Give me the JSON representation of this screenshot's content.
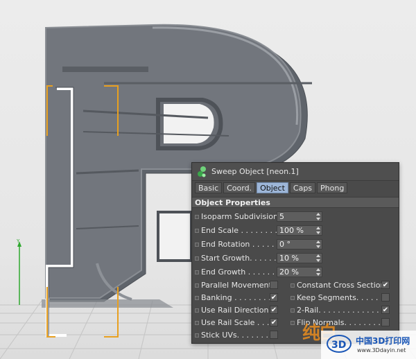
{
  "panel": {
    "title": "Sweep Object [neon.1]",
    "tabs": [
      {
        "label": "Basic",
        "active": false
      },
      {
        "label": "Coord.",
        "active": false
      },
      {
        "label": "Object",
        "active": true
      },
      {
        "label": "Caps",
        "active": false
      },
      {
        "label": "Phong",
        "active": false
      }
    ],
    "section_title": "Object Properties",
    "numeric_fields": [
      {
        "label": "Isoparm Subdivision",
        "value": "5"
      },
      {
        "label": "End Scale . . . . . . . . .",
        "value": "100 %"
      },
      {
        "label": "End Rotation . . . . . .",
        "value": "0 °"
      },
      {
        "label": "Start Growth. . . . . . .",
        "value": "10 %"
      },
      {
        "label": "End Growth . . . . . . .",
        "value": "20 %"
      }
    ],
    "checkboxes_left": [
      {
        "label": "Parallel Movement",
        "checked": false
      },
      {
        "label": "Banking . . . . . . . . .",
        "checked": true
      },
      {
        "label": "Use Rail Direction",
        "checked": true
      },
      {
        "label": "Use Rail Scale . . . .",
        "checked": true
      },
      {
        "label": "Stick UVs. . . . . . . . .",
        "checked": false
      }
    ],
    "checkboxes_right": [
      {
        "label": "Constant Cross Section",
        "checked": true
      },
      {
        "label": "Keep Segments. . . . . . .",
        "checked": false
      },
      {
        "label": "2-Rail. . . . . . . . . . . . . .",
        "checked": true
      },
      {
        "label": "Flip Normals. . . . . . . . .",
        "checked": false
      }
    ]
  },
  "viewport": {
    "axis_label": "Y"
  },
  "watermark": {
    "site_cn": "中国3D打印网",
    "site_url": "www.3Ddayin.net",
    "overlay_text": "纯白"
  },
  "colors": {
    "object_gray": "#6c7077",
    "selection_orange": "#e8a020",
    "panel_bg": "#4a4a4a",
    "active_tab": "#9db6d8",
    "watermark_blue": "#1a56b6"
  }
}
